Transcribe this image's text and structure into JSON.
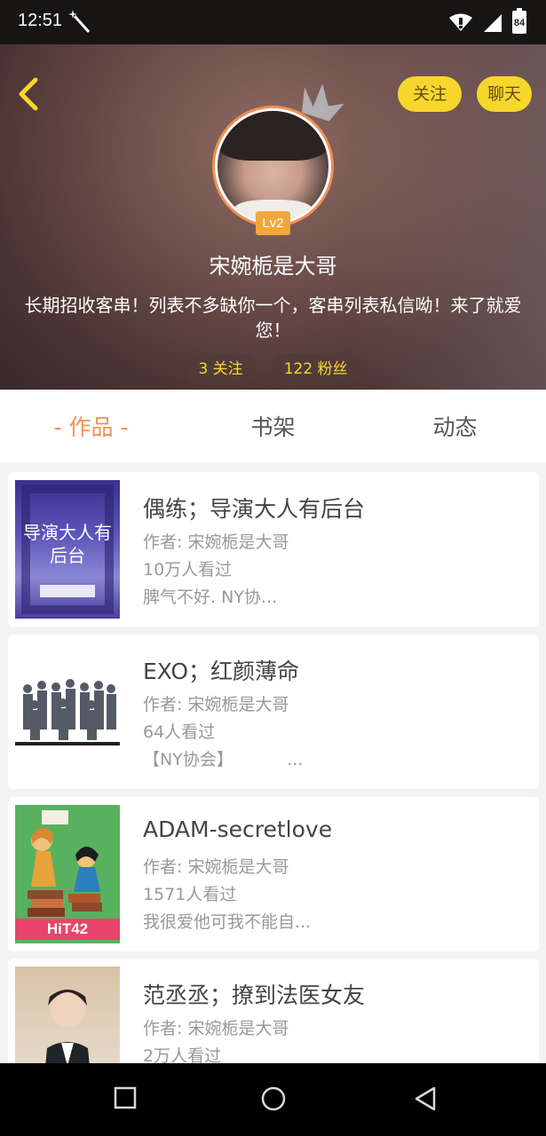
{
  "status": {
    "time": "12:51",
    "battery": "84"
  },
  "header": {
    "follow_label": "关注",
    "chat_label": "聊天",
    "level": "Lv2",
    "username": "宋婉栀是大哥",
    "bio": "长期招收客串！列表不多缺你一个，客串列表私信呦！来了就爱您！",
    "following": "3 关注",
    "followers": "122 粉丝"
  },
  "tabs": [
    {
      "label": "- 作品 -"
    },
    {
      "label": "书架"
    },
    {
      "label": "动态"
    }
  ],
  "books": [
    {
      "title": "偶练；导演大人有后台",
      "author": "作者: 宋婉栀是大哥",
      "views": "10万人看过",
      "desc": "脾气不好. NY协...",
      "cover_text": "导演大人有后台"
    },
    {
      "title": "EXO；红颜薄命",
      "author": "作者: 宋婉栀是大哥",
      "views": "64人看过",
      "desc": "【NY协会】          ..."
    },
    {
      "title": "ADAM-secretlove",
      "author": "作者: 宋婉栀是大哥",
      "views": "1571人看过",
      "desc": "我很爱他可我不能自...",
      "cover_text": "HiT42"
    },
    {
      "title": "范丞丞；撩到法医女友",
      "author": "作者: 宋婉栀是大哥",
      "views": "2万人看过",
      "desc": ""
    }
  ],
  "colors": {
    "accent": "#f19053",
    "yellow": "#f7d72c"
  }
}
